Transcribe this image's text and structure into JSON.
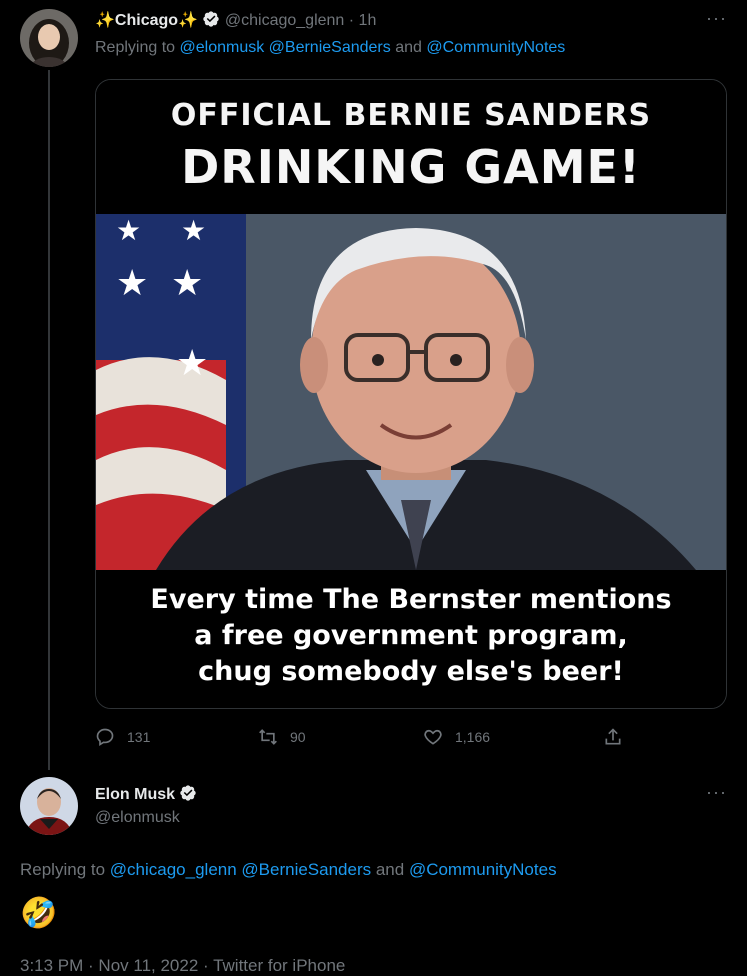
{
  "first_tweet": {
    "display_name": "✨Chicago✨",
    "handle": "@chicago_glenn",
    "time_ago": "· 1h",
    "replying_prefix": "Replying to ",
    "replying_to": "@elonmusk @BernieSanders",
    "replying_and": " and ",
    "replying_to_last": "@CommunityNotes",
    "image": {
      "title_line1": "OFFICIAL BERNIE SANDERS",
      "title_line2": "DRINKING GAME!",
      "caption_line1": "Every time The Bernster mentions",
      "caption_line2": "a free government program,",
      "caption_line3": "chug somebody else's beer!"
    },
    "actions": {
      "replies": "131",
      "retweets": "90",
      "likes": "1,166"
    }
  },
  "second_tweet": {
    "display_name": "Elon Musk",
    "handle": "@elonmusk",
    "replying_prefix": "Replying to ",
    "replying_to": "@chicago_glenn @BernieSanders",
    "replying_and": " and ",
    "replying_to_last": "@CommunityNotes",
    "body_emoji": "🤣",
    "timestamp": "3:13 PM · Nov 11, 2022 · Twitter for iPhone"
  },
  "more_glyph": "···",
  "colors": {
    "background": "#000000",
    "text": "#e7e9ea",
    "muted": "#71767b",
    "link": "#1d9bf0",
    "verified": "#e7e9ea"
  }
}
